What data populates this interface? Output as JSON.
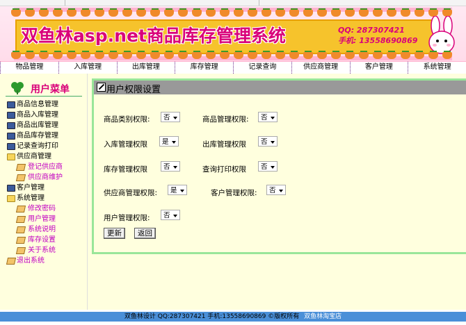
{
  "banner": {
    "title": "双鱼林asp.net商品库存管理系统",
    "qq": "QQ: 287307421",
    "phone": "手机: 13558690869"
  },
  "nav": [
    "物品管理",
    "入库管理",
    "出库管理",
    "库存管理",
    "记录查询",
    "供应商管理",
    "客户管理",
    "系统管理"
  ],
  "sidebar": {
    "title": "用户菜单",
    "items": [
      {
        "label": "商品信息管理",
        "icon": "cube-icon"
      },
      {
        "label": "商品入库管理",
        "icon": "cube-icon"
      },
      {
        "label": "商品出库管理",
        "icon": "cube-icon"
      },
      {
        "label": "商品库存管理",
        "icon": "cube-icon"
      },
      {
        "label": "记录查询打印",
        "icon": "cube-icon"
      },
      {
        "label": "供应商管理",
        "icon": "folder-open-icon"
      },
      {
        "label": "登记供应商",
        "icon": "document-icon",
        "sub": true
      },
      {
        "label": "供应商维护",
        "icon": "document-icon",
        "sub": true
      },
      {
        "label": "客户管理",
        "icon": "cube-icon"
      },
      {
        "label": "系统管理",
        "icon": "folder-open-icon"
      },
      {
        "label": "修改密码",
        "icon": "document-icon",
        "sub": true
      },
      {
        "label": "用户管理",
        "icon": "document-icon",
        "sub": true
      },
      {
        "label": "系统说明",
        "icon": "document-icon",
        "sub": true
      },
      {
        "label": "库存设置",
        "icon": "document-icon",
        "sub": true
      },
      {
        "label": "关于系统",
        "icon": "document-icon",
        "sub": true
      },
      {
        "label": "退出系统",
        "icon": "exit-icon"
      }
    ]
  },
  "panel": {
    "title": "用户权限设置",
    "fields": {
      "category": {
        "label": "商品类别权限:",
        "value": "否"
      },
      "product": {
        "label": "商品管理权限:",
        "value": "否"
      },
      "stock_in": {
        "label": "入库管理权限",
        "value": "是"
      },
      "stock_out": {
        "label": "出库管理权限",
        "value": "否"
      },
      "inventory": {
        "label": "库存管理权限",
        "value": "否"
      },
      "query_print": {
        "label": "查询打印权限",
        "value": "否"
      },
      "supplier": {
        "label": "供应商管理权限:",
        "value": "是"
      },
      "customer": {
        "label": "客户管理权限:",
        "value": "否"
      },
      "user": {
        "label": "用户管理权限:",
        "value": "否"
      }
    },
    "buttons": {
      "update": "更新",
      "back": "返回"
    }
  },
  "footer": {
    "text": "双鱼林设计  QQ:287307421 手机:13558690869 ©版权所有",
    "link": "双鱼林淘宝店"
  },
  "colors": {
    "accent": "#d9007a",
    "sidebar_bg": "#ffffde",
    "panel_border": "#99e699",
    "panel_header": "#999999",
    "footer_bg": "#4a8fd8",
    "submenu_text": "#c200c2"
  }
}
